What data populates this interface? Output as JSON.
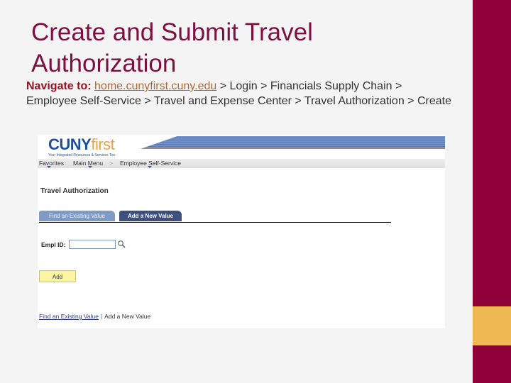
{
  "slide": {
    "title": "Create and Submit Travel Authorization",
    "navigate_label": "Navigate to:",
    "navigate_link": "home.cunyfirst.cuny.edu",
    "navigate_path": " > Login > Financials Supply Chain > Employee Self-Service > Travel and Expense Center > Travel Authorization > Create"
  },
  "theme": {
    "accent_maroon": "#8f0038",
    "accent_gold": "#efb852"
  },
  "screenshot": {
    "logo": {
      "brand_bold": "CUNY",
      "brand_light": "first",
      "tagline": "Your Integrated Resources & Services Too"
    },
    "menu": {
      "items": [
        "Favorites",
        "Main Menu",
        "Employee Self-Service"
      ],
      "separator": ">"
    },
    "page_title": "Travel Authorization",
    "tabs": [
      {
        "label": "Find an Existing Value",
        "active": false
      },
      {
        "label": "Add a New Value",
        "active": true
      }
    ],
    "form": {
      "empl_id_label": "Empl ID:",
      "empl_id_value": "",
      "lookup_icon": "magnifier-icon",
      "add_button": "Add"
    },
    "bottom_links": {
      "find": "Find an Existing Value",
      "add": "Add a New Value"
    }
  }
}
